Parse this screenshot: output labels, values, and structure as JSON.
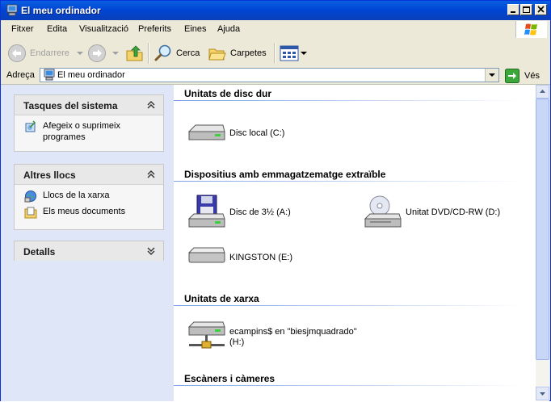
{
  "window": {
    "title": "El meu ordinador"
  },
  "menubar": {
    "items": [
      {
        "label": "Fitxer"
      },
      {
        "label": "Edita"
      },
      {
        "label": "Visualització"
      },
      {
        "label": "Preferits"
      },
      {
        "label": "Eines"
      },
      {
        "label": "Ajuda"
      }
    ]
  },
  "toolbar": {
    "back_label": "Endarrere",
    "search_label": "Cerca",
    "folders_label": "Carpetes"
  },
  "address": {
    "label": "Adreça",
    "value": "El meu ordinador",
    "go_label": "Vés"
  },
  "sidebar": {
    "system_tasks": {
      "title": "Tasques del sistema",
      "items": [
        {
          "label": "Afegeix o suprimeix programes"
        }
      ]
    },
    "other_places": {
      "title": "Altres llocs",
      "items": [
        {
          "label": "Llocs de la xarxa"
        },
        {
          "label": "Els meus documents"
        }
      ]
    },
    "details": {
      "title": "Detalls"
    }
  },
  "main": {
    "groups": [
      {
        "title": "Unitats de disc dur",
        "items": [
          {
            "label": "Disc local (C:)"
          }
        ]
      },
      {
        "title": "Dispositius amb emmagatzematge extraïble",
        "items": [
          {
            "label": "Disc de 3½ (A:)"
          },
          {
            "label": "Unitat DVD/CD-RW (D:)"
          },
          {
            "label": "KINGSTON (E:)"
          }
        ]
      },
      {
        "title": "Unitats de xarxa",
        "items": [
          {
            "label": "ecampins$ en \"biesjmquadrado\" (H:)"
          }
        ]
      },
      {
        "title": "Escàners i càmeres",
        "items": []
      }
    ]
  },
  "colors": {
    "titlebar": "#0a5fe0",
    "accent": "#7ba2e7",
    "chrome": "#ece9d8"
  }
}
